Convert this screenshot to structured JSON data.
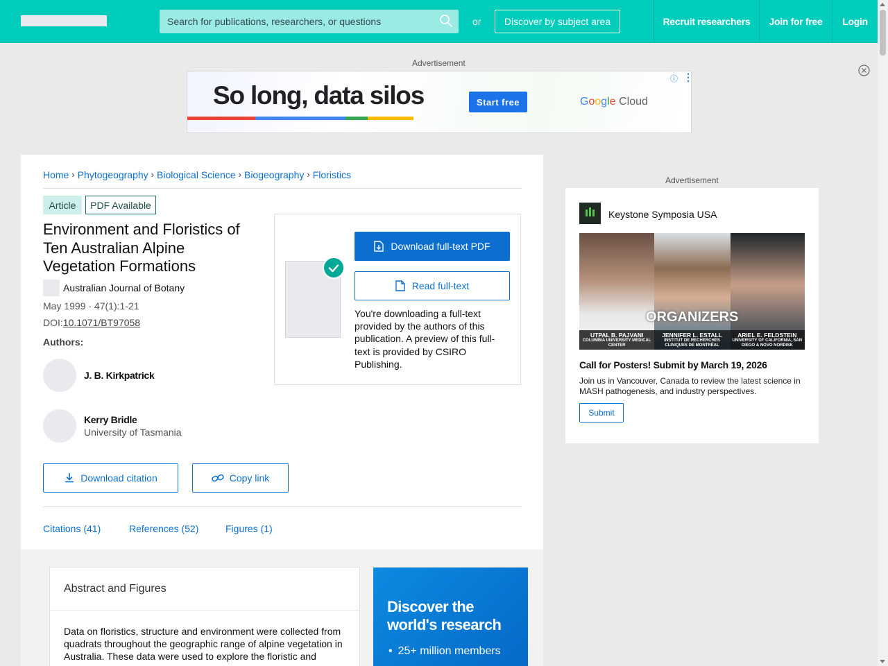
{
  "header": {
    "search_placeholder": "Search for publications, researchers, or questions",
    "or_text": "or",
    "discover_label": "Discover by subject area",
    "nav": [
      "Recruit researchers",
      "Join for free",
      "Login"
    ]
  },
  "ads": {
    "label": "Advertisement",
    "top": {
      "headline": "So long, data silos",
      "cta": "Start free",
      "brand": "Google Cloud"
    },
    "right": {
      "label": "Advertisement",
      "sponsor": "Keystone Symposia USA",
      "overlay": "ORGANIZERS",
      "people": [
        {
          "name": "UTPAL B. PAJVANI",
          "affiliation": "COLUMBIA UNIVERSITY MEDICAL CENTER"
        },
        {
          "name": "JENNIFER L. ESTALL",
          "affiliation": "INSTITUT DE RECHERCHES CLINIQUES DE MONTRÉAL"
        },
        {
          "name": "ARIEL E. FELDSTEIN",
          "affiliation": "UNIVERSITY OF CALIFORNIA, SAN DIEGO & NOVO NORDISK"
        }
      ],
      "headline": "Call for Posters! Submit by March 19, 2026",
      "body": "Join us in Vancouver, Canada to review the latest science in MASH pathogenesis, and industry perspectives.",
      "cta": "Submit"
    }
  },
  "breadcrumb": [
    "Home",
    "Phytogeography",
    "Biological Science",
    "Biogeography",
    "Floristics"
  ],
  "article": {
    "type_badge": "Article",
    "pdf_badge": "PDF Available",
    "title": "Environment and Floristics of Ten Australian Alpine Vegetation Formations",
    "journal": "Australian Journal of Botany",
    "date": "May 1999 · 47(1):1-21",
    "doi_label": "DOI:",
    "doi": "10.1071/BT97058",
    "authors_label": "Authors:",
    "authors": [
      {
        "name": "J. B. Kirkpatrick",
        "affiliation": ""
      },
      {
        "name": "Kerry Bridle",
        "affiliation": "University of Tasmania"
      }
    ],
    "download_citation": "Download citation",
    "copy_link": "Copy link"
  },
  "download_box": {
    "primary": "Download full-text PDF",
    "secondary": "Read full-text",
    "note": "You're downloading a full-text provided by the authors of this publication. A preview of this full-text is provided by CSIRO Publishing."
  },
  "tabs": [
    "Citations (41)",
    "References (52)",
    "Figures (1)"
  ],
  "abstract": {
    "heading": "Abstract and Figures",
    "text": "Data on floristics, structure and environment were collected from quadrats throughout the geographic range of alpine vegetation in Australia. These data were used to explore the floristic and environmental relationships of ten alpine vegetation formations."
  },
  "promo": {
    "heading": "Discover the world's research",
    "bullet": "25+ million members"
  },
  "colors": {
    "brand_teal": "#00ccbb",
    "link_blue": "#0c6fd0",
    "check_green": "#00a895"
  }
}
